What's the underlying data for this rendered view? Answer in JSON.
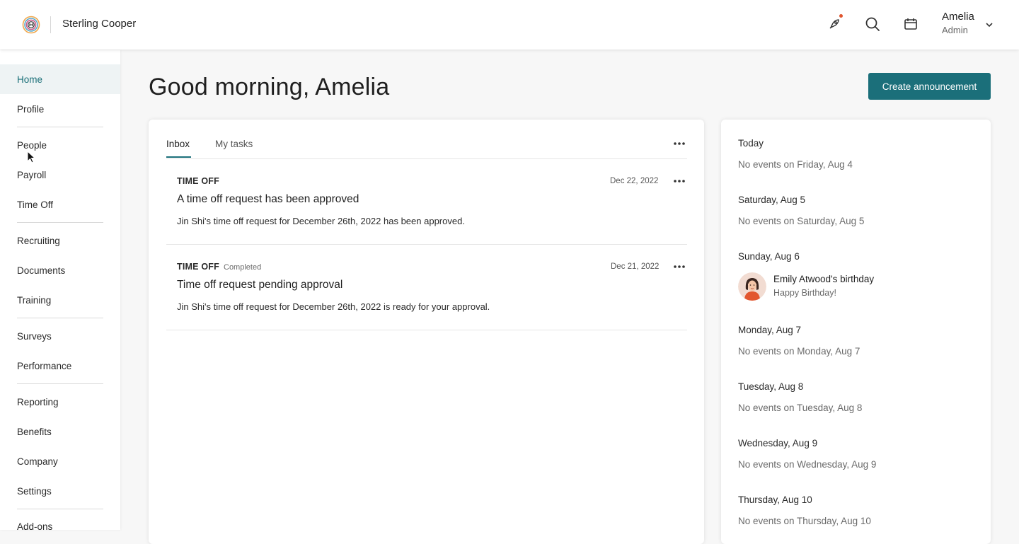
{
  "header": {
    "company": "Sterling Cooper",
    "user": {
      "name": "Amelia",
      "role": "Admin"
    },
    "icons": [
      "logo-icon",
      "rocket-icon",
      "search-icon",
      "calendar-icon",
      "chevron-down-icon"
    ],
    "notification_color": "#e0552e"
  },
  "sidebar": {
    "items": [
      {
        "label": "Home",
        "active": true
      },
      {
        "label": "Profile"
      },
      {
        "label": "People"
      },
      {
        "label": "Payroll"
      },
      {
        "label": "Time Off"
      },
      {
        "label": "Recruiting"
      },
      {
        "label": "Documents"
      },
      {
        "label": "Training"
      },
      {
        "label": "Surveys"
      },
      {
        "label": "Performance"
      },
      {
        "label": "Reporting"
      },
      {
        "label": "Benefits"
      },
      {
        "label": "Company"
      },
      {
        "label": "Settings"
      },
      {
        "label": "Add-ons"
      }
    ]
  },
  "main": {
    "greeting": "Good morning, Amelia",
    "create_button": "Create announcement",
    "accent_color": "#1b6f7a"
  },
  "inbox": {
    "tabs": [
      {
        "label": "Inbox",
        "active": true
      },
      {
        "label": "My tasks"
      }
    ],
    "messages": [
      {
        "type": "TIME OFF",
        "status": "",
        "date": "Dec 22, 2022",
        "title": "A time off request has been approved",
        "body": "Jin Shi's time off request for December 26th, 2022 has been approved."
      },
      {
        "type": "TIME OFF",
        "status": "Completed",
        "date": "Dec 21, 2022",
        "title": "Time off request pending approval",
        "body": "Jin Shi's time off request for December 26th, 2022 is ready for your approval."
      }
    ]
  },
  "events": {
    "days": [
      {
        "date": "Today",
        "text": "No events on Friday, Aug 4"
      },
      {
        "date": "Saturday, Aug 5",
        "text": "No events on Saturday, Aug 5"
      },
      {
        "date": "Sunday, Aug 6",
        "event_title": "Emily Atwood's birthday",
        "event_sub": "Happy Birthday!"
      },
      {
        "date": "Monday, Aug 7",
        "text": "No events on Monday, Aug 7"
      },
      {
        "date": "Tuesday, Aug 8",
        "text": "No events on Tuesday, Aug 8"
      },
      {
        "date": "Wednesday, Aug 9",
        "text": "No events on Wednesday, Aug 9"
      },
      {
        "date": "Thursday, Aug 10",
        "text": "No events on Thursday, Aug 10"
      }
    ]
  }
}
